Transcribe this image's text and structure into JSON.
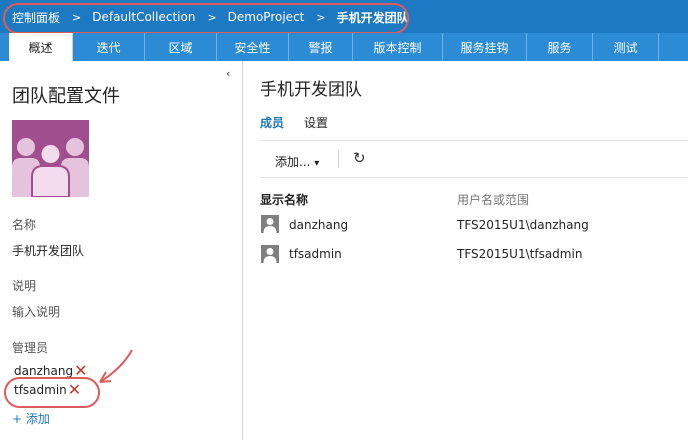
{
  "breadcrumb": {
    "items": [
      "控制面板",
      "DefaultCollection",
      "DemoProject",
      "手机开发团队"
    ],
    "separator": ">"
  },
  "tabs": [
    "概述",
    "迭代",
    "区域",
    "安全性",
    "警报",
    "版本控制",
    "服务挂钩",
    "服务",
    "测试"
  ],
  "active_tab": "概述",
  "left_panel": {
    "collapse_icon": "‹",
    "title": "团队配置文件",
    "avatar_icon": "team-avatar-icon",
    "name_label": "名称",
    "name_value": "手机开发团队",
    "desc_label": "说明",
    "desc_value": "输入说明",
    "admins_label": "管理员",
    "admins": [
      "danzhang",
      "tfsadmin"
    ],
    "remove_glyph": "✕",
    "add_link": "+ 添加"
  },
  "main": {
    "title": "手机开发团队",
    "pivots": [
      "成员",
      "设置"
    ],
    "active_pivot": "成员",
    "toolbar": {
      "add_label": "添加...",
      "add_caret": "▾",
      "refresh_glyph": "↻"
    },
    "columns": [
      "显示名称",
      "用户名或范围"
    ],
    "members": [
      {
        "name": "danzhang",
        "account": "TFS2015U1\\danzhang"
      },
      {
        "name": "tfsadmin",
        "account": "TFS2015U1\\tfsadmin"
      }
    ]
  },
  "colors": {
    "topbar": "#1e79c3",
    "tabbar": "#2b8bd4",
    "accent": "#1e79c3",
    "annotation": "#e05a5a",
    "avatar_bg": "#a14e8e",
    "remove": "#c0392b"
  }
}
